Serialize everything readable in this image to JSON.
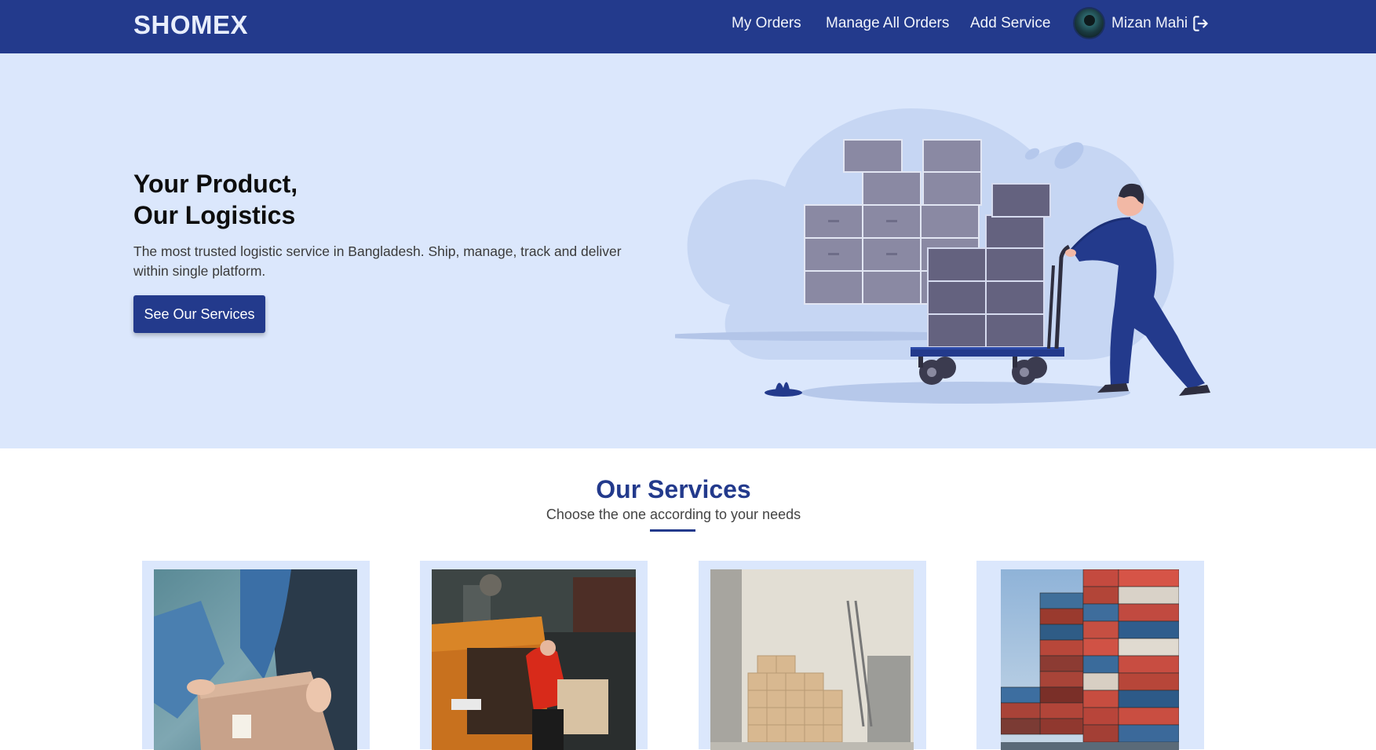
{
  "navbar": {
    "brand": "SHOMEX",
    "links": [
      "My Orders",
      "Manage All Orders",
      "Add Service"
    ],
    "user_name": "Mizan Mahi",
    "logout_icon": "logout-icon",
    "avatar_icon": "user-avatar"
  },
  "hero": {
    "title_line1": "Your Product,",
    "title_line2": "Our Logistics",
    "description": "The most trusted logistic service in Bangladesh. Ship, manage, track and deliver within single platform.",
    "button_label": "See Our Services"
  },
  "services": {
    "title": "Our Services",
    "subtitle": "Choose the one according to your needs",
    "cards": [
      {
        "image": "parcel-handover-photo"
      },
      {
        "image": "delivery-van-photo"
      },
      {
        "image": "warehouse-boxes-photo"
      },
      {
        "image": "shipping-containers-photo"
      }
    ]
  },
  "colors": {
    "primary": "#233a8c",
    "hero_bg": "#dbe7fc",
    "text_dark": "#0d0d0d"
  }
}
